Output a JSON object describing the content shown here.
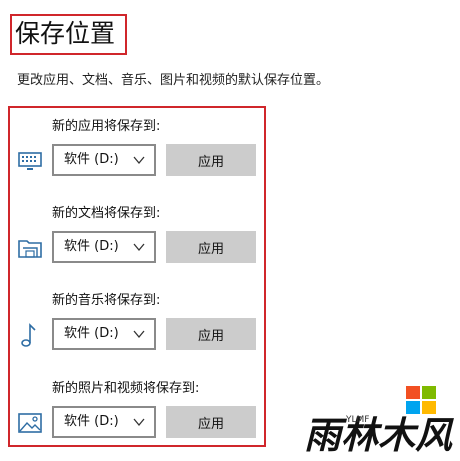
{
  "page": {
    "title": "保存位置",
    "description": "更改应用、文档、音乐、图片和视频的默认保存位置。"
  },
  "locations": [
    {
      "label": "新的应用将保存到:",
      "icon": "monitor-icon",
      "drive": "软件 (D:)",
      "button": "应用"
    },
    {
      "label": "新的文档将保存到:",
      "icon": "folder-icon",
      "drive": "软件 (D:)",
      "button": "应用"
    },
    {
      "label": "新的音乐将保存到:",
      "icon": "music-note-icon",
      "drive": "软件 (D:)",
      "button": "应用"
    },
    {
      "label": "新的照片和视频将保存到:",
      "icon": "picture-icon",
      "drive": "软件 (D:)",
      "button": "应用"
    }
  ],
  "watermark": {
    "text": "雨林木风",
    "subtext": "YLMF"
  },
  "colors": {
    "highlight_border": "#d0262b",
    "button_bg": "#cccccc",
    "icon_blue": "#2e6da4"
  }
}
